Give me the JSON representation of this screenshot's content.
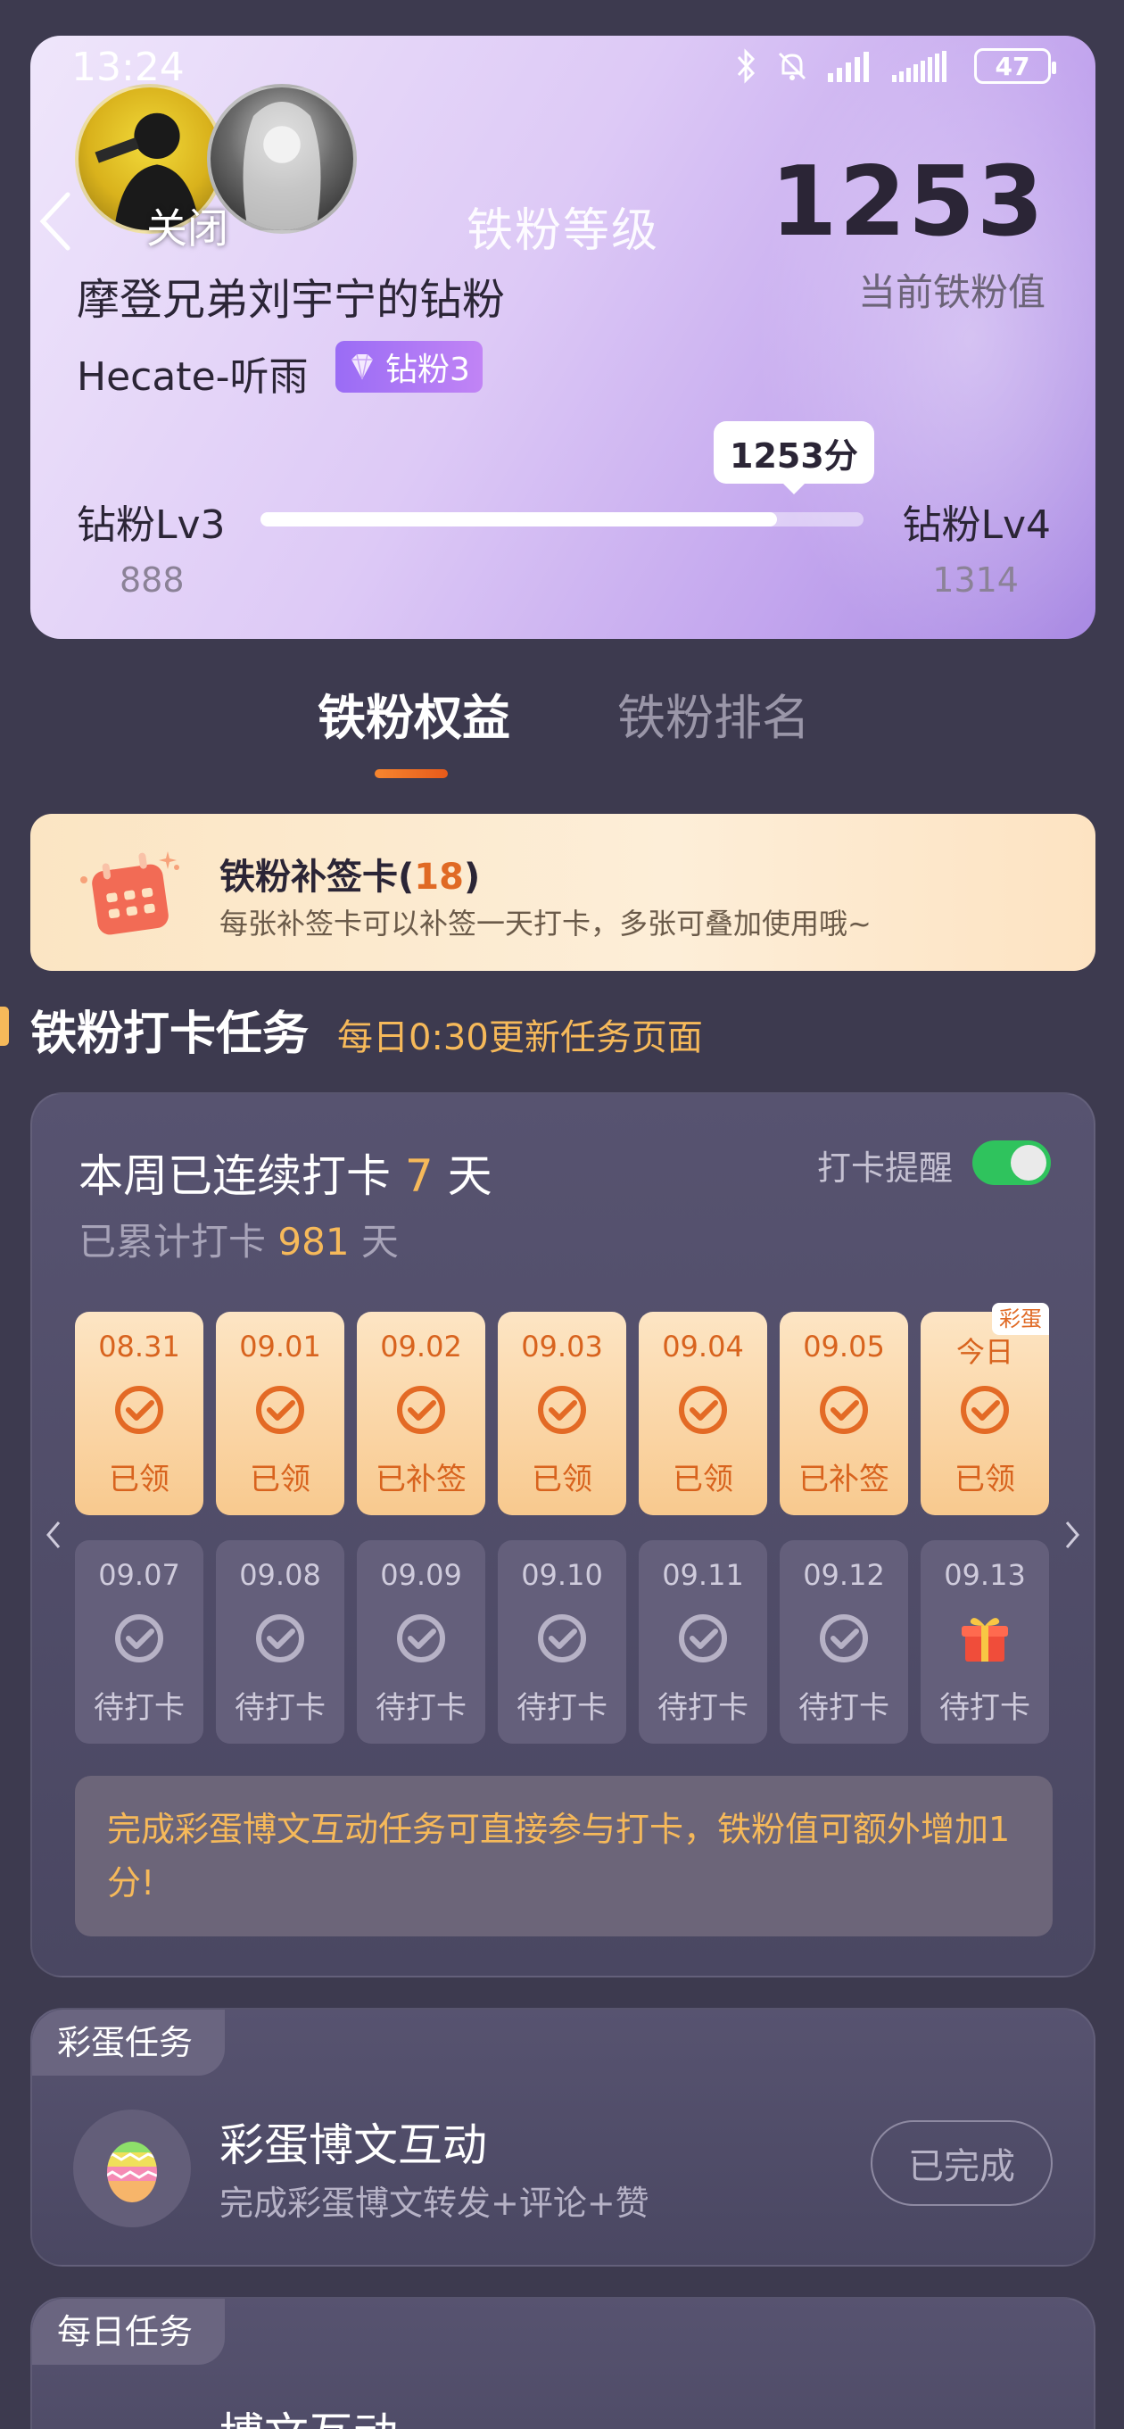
{
  "status_bar": {
    "time": "13:24",
    "battery": "47"
  },
  "header": {
    "overlay_text": "关闭",
    "title": "铁粉等级",
    "score": "1253",
    "score_label": "当前铁粉值",
    "fan_title": "摩登兄弟刘宇宁的钻粉",
    "username": "Hecate-听雨",
    "badge": "钻粉3",
    "score_tip": "1253分",
    "level_left": "钻粉Lv3",
    "level_right": "钻粉Lv4",
    "level_left_value": "888",
    "level_right_value": "1314",
    "progress_value": 1253,
    "progress_min": 888,
    "progress_max": 1314
  },
  "tabs": [
    {
      "label": "铁粉权益",
      "active": true
    },
    {
      "label": "铁粉排名",
      "active": false
    }
  ],
  "sign_card": {
    "title": "铁粉补签卡",
    "count_open": "(",
    "count": "18",
    "count_close": ")",
    "desc": "每张补签卡可以补签一天打卡，多张可叠加使用哦~"
  },
  "section": {
    "title": "铁粉打卡任务",
    "subtitle": "每日0:30更新任务页面"
  },
  "checkin": {
    "streak_prefix": "本周已连续打卡",
    "streak_days": "7",
    "streak_suffix": "天",
    "total_prefix": "已累计打卡",
    "total_days": "981",
    "total_suffix": "天",
    "remind_label": "打卡提醒",
    "remind_on": true,
    "egg_tag": "彩蛋",
    "week1": [
      {
        "date": "08.31",
        "status": "已领"
      },
      {
        "date": "09.01",
        "status": "已领"
      },
      {
        "date": "09.02",
        "status": "已补签"
      },
      {
        "date": "09.03",
        "status": "已领"
      },
      {
        "date": "09.04",
        "status": "已领"
      },
      {
        "date": "09.05",
        "status": "已补签"
      },
      {
        "date": "今日",
        "status": "已领"
      }
    ],
    "week2": [
      {
        "date": "09.07",
        "status": "待打卡"
      },
      {
        "date": "09.08",
        "status": "待打卡"
      },
      {
        "date": "09.09",
        "status": "待打卡"
      },
      {
        "date": "09.10",
        "status": "待打卡"
      },
      {
        "date": "09.11",
        "status": "待打卡"
      },
      {
        "date": "09.12",
        "status": "待打卡"
      },
      {
        "date": "09.13",
        "status": "待打卡"
      }
    ],
    "tip": "完成彩蛋博文互动任务可直接参与打卡，铁粉值可额外增加1分!"
  },
  "egg_task": {
    "tag": "彩蛋任务",
    "title": "彩蛋博文互动",
    "desc": "完成彩蛋博文转发+评论+赞",
    "button": "已完成"
  },
  "daily_task": {
    "tag": "每日任务",
    "title_peek": "博文互动"
  },
  "colors": {
    "accent": "#f6b95a",
    "orange": "#e06a25",
    "toggle": "#2fc35d",
    "page_bg": "#3d3a4f"
  }
}
